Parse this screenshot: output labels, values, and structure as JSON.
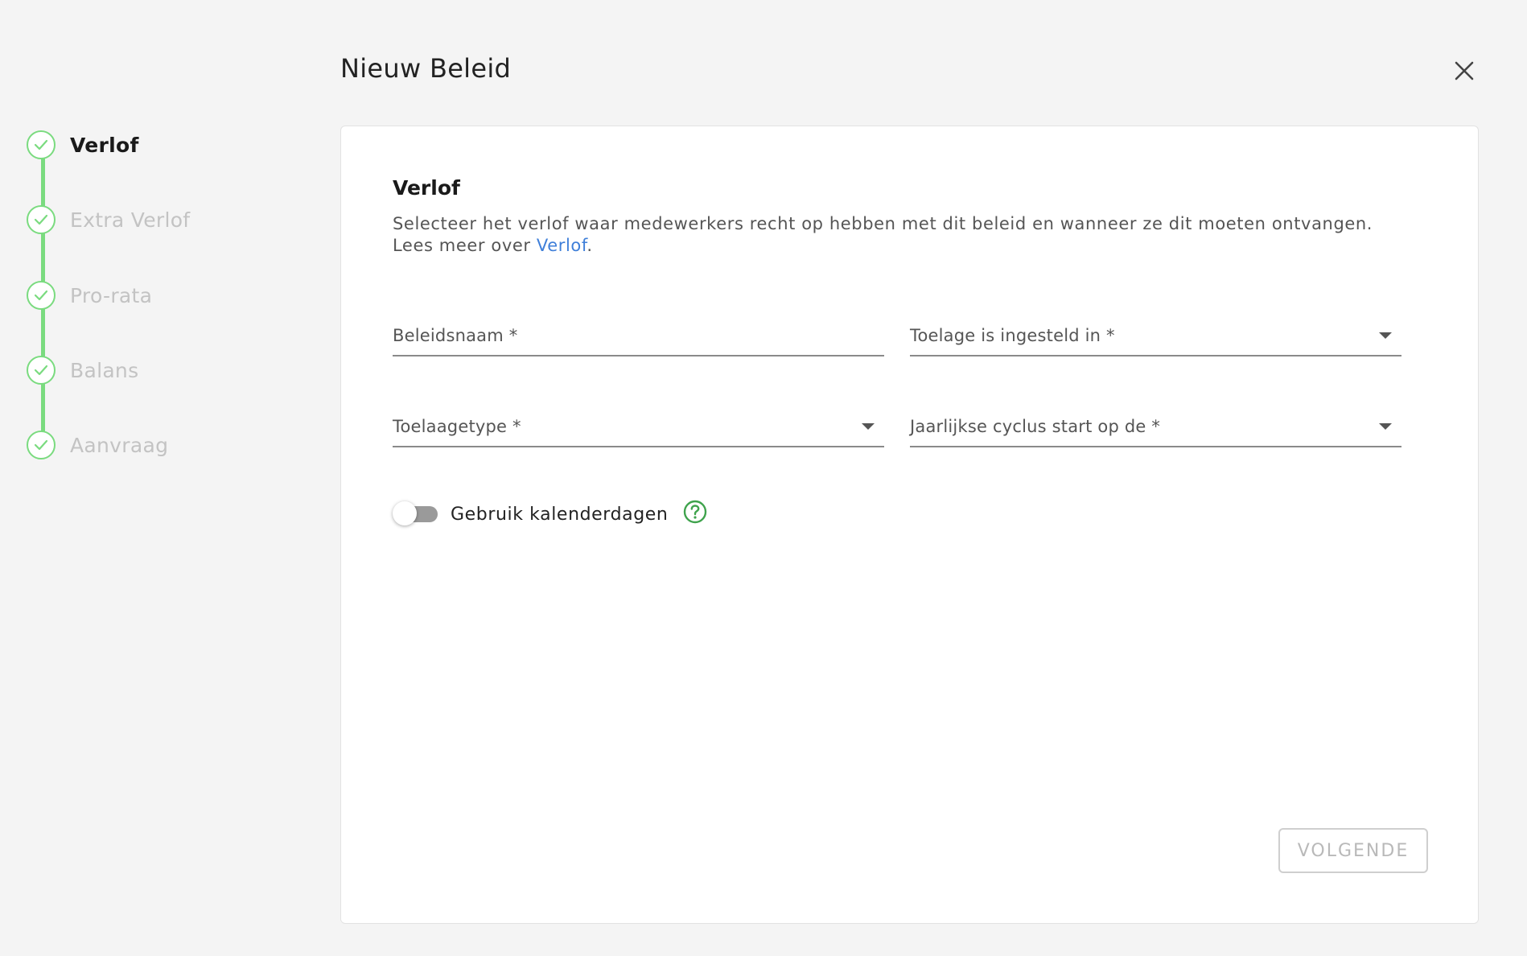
{
  "dialog": {
    "title": "Nieuw Beleid",
    "close_icon": "close-icon"
  },
  "stepper": {
    "accent_color": "#7adb7f",
    "steps": [
      {
        "label": "Verlof",
        "active": true
      },
      {
        "label": "Extra Verlof",
        "active": false
      },
      {
        "label": "Pro-rata",
        "active": false
      },
      {
        "label": "Balans",
        "active": false
      },
      {
        "label": "Aanvraag",
        "active": false
      }
    ]
  },
  "section": {
    "title": "Verlof",
    "description": "Selecteer het verlof waar medewerkers recht op hebben met dit beleid en wanneer ze dit moeten ontvangen. Lees meer over ",
    "link_text": "Verlof",
    "description_end": "."
  },
  "form": {
    "policy_name_label": "Beleidsnaam *",
    "allowance_unit_label": "Toelage is ingesteld in *",
    "allowance_type_label": "Toelaagetype *",
    "annual_cycle_label": "Jaarlijkse cyclus start op de *"
  },
  "toggle": {
    "label": "Gebruik kalenderdagen",
    "checked": false,
    "help_icon": "help-circle-icon",
    "help_icon_color": "#3fa34d"
  },
  "footer": {
    "next_label": "VOLGENDE",
    "next_disabled": true
  },
  "colors": {
    "link": "#3f7fd9",
    "background": "#f4f4f4"
  }
}
